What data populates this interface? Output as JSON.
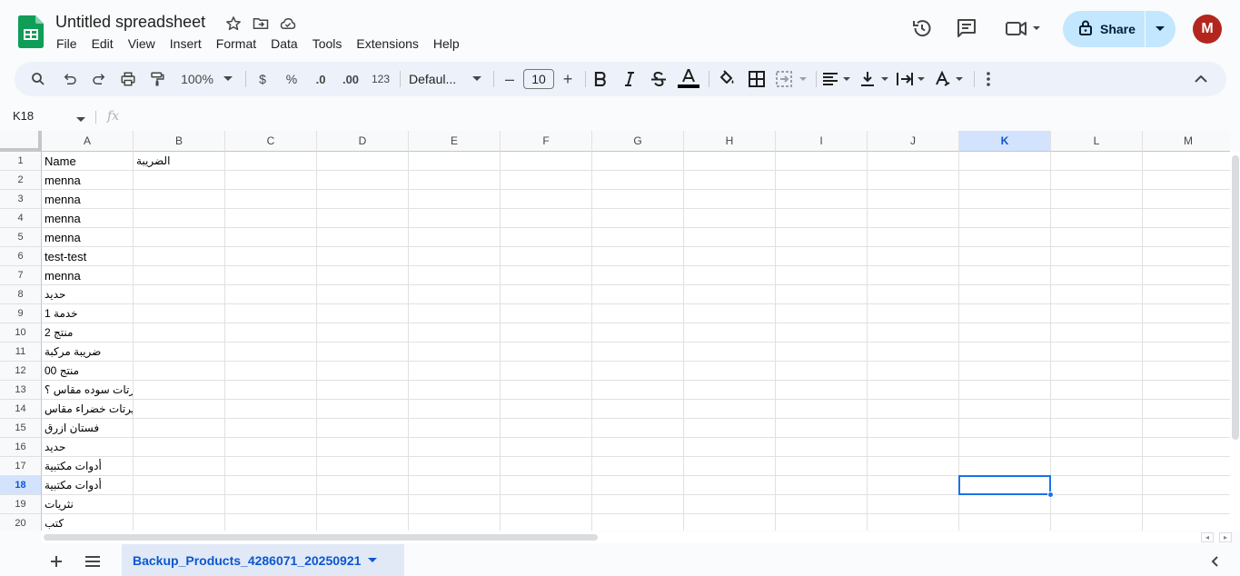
{
  "header": {
    "title": "Untitled spreadsheet",
    "menu": [
      "File",
      "Edit",
      "View",
      "Insert",
      "Format",
      "Data",
      "Tools",
      "Extensions",
      "Help"
    ],
    "share_label": "Share",
    "avatar_initial": "M"
  },
  "toolbar": {
    "zoom": "100%",
    "currency": "$",
    "percent": "%",
    "dec_decrease": ".0",
    "dec_increase": ".00",
    "more_formats": "123",
    "font": "Defaul...",
    "font_size": "10",
    "minus": "–",
    "plus": "+"
  },
  "formula_bar": {
    "cell_ref": "K18",
    "fx": "fx"
  },
  "grid": {
    "columns": [
      "A",
      "B",
      "C",
      "D",
      "E",
      "F",
      "G",
      "H",
      "I",
      "J",
      "K",
      "L",
      "M"
    ],
    "selected_column": "K",
    "selected_row": "18",
    "rows": [
      {
        "n": "1",
        "a": "Name",
        "b": "الضريبة",
        "a_rtl": false
      },
      {
        "n": "2",
        "a": "menna",
        "b": "",
        "a_rtl": false
      },
      {
        "n": "3",
        "a": "menna",
        "b": "",
        "a_rtl": false
      },
      {
        "n": "4",
        "a": "menna",
        "b": "",
        "a_rtl": false
      },
      {
        "n": "5",
        "a": "menna",
        "b": "",
        "a_rtl": false
      },
      {
        "n": "6",
        "a": "test-test",
        "b": "",
        "a_rtl": false
      },
      {
        "n": "7",
        "a": "menna",
        "b": "",
        "a_rtl": false
      },
      {
        "n": "8",
        "a": "حديد",
        "b": "",
        "a_rtl": true
      },
      {
        "n": "9",
        "a": "خدمة 1",
        "b": "",
        "a_rtl": true
      },
      {
        "n": "10",
        "a": "منتج 2",
        "b": "",
        "a_rtl": true
      },
      {
        "n": "11",
        "a": "ضريبة مركبة",
        "b": "",
        "a_rtl": true
      },
      {
        "n": "12",
        "a": "منتج 00",
        "b": "",
        "a_rtl": true
      },
      {
        "n": "13",
        "a": "تيشيرتات سوده مقاس ؟",
        "b": "",
        "a_rtl": true
      },
      {
        "n": "14",
        "a": "تيشيرتات خضراء مقاس",
        "b": "",
        "a_rtl": true
      },
      {
        "n": "15",
        "a": "فستان ازرق",
        "b": "",
        "a_rtl": true
      },
      {
        "n": "16",
        "a": "حديد",
        "b": "",
        "a_rtl": true
      },
      {
        "n": "17",
        "a": "أدوات مكتبية",
        "b": "",
        "a_rtl": true
      },
      {
        "n": "18",
        "a": "أدوات مكتبية",
        "b": "",
        "a_rtl": true
      },
      {
        "n": "19",
        "a": "نثريات",
        "b": "",
        "a_rtl": true
      },
      {
        "n": "20",
        "a": "كتب",
        "b": "",
        "a_rtl": true
      }
    ]
  },
  "sheets": {
    "active": "Backup_Products_4286071_20250921"
  },
  "icons": {
    "logo": "sheets-logo-icon",
    "star": "star-icon",
    "move": "move-folder-icon",
    "cloud": "cloud-status-icon",
    "history": "history-icon",
    "comments": "comments-icon",
    "meet": "meet-video-icon",
    "lock": "lock-icon"
  },
  "colors": {
    "accent": "#0b57d0",
    "share_bg": "#c2e7ff",
    "avatar_bg": "#b3261e",
    "logo_green": "#0f9d58",
    "selection": "#1a73e8"
  }
}
